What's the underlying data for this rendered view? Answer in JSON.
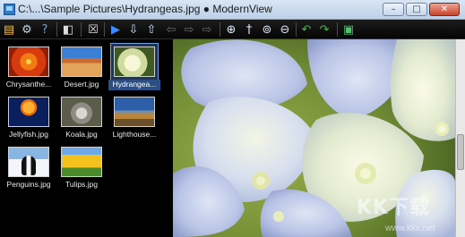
{
  "window": {
    "title": "C:\\...\\Sample Pictures\\Hydrangeas.jpg ● ModernView",
    "minimize_glyph": "–",
    "maximize_glyph": "□",
    "close_glyph": "✕"
  },
  "toolbar": {
    "icons": [
      {
        "name": "open-folder-icon",
        "glyph": "▤",
        "color": "#f0c14b"
      },
      {
        "name": "settings-icon",
        "glyph": "⚙",
        "color": "#c7d3e4"
      },
      {
        "name": "help-icon",
        "glyph": "?",
        "color": "#5aa6ff"
      },
      {
        "name": "panel-toggle-icon",
        "glyph": "◧",
        "color": "#dddddd"
      },
      {
        "name": "delete-icon",
        "glyph": "☒",
        "color": "#dddddd"
      },
      {
        "name": "play-slideshow-icon",
        "glyph": "▶",
        "color": "#3b8cff"
      },
      {
        "name": "download-arrow-icon",
        "glyph": "⇩",
        "color": "#cfe3ff"
      },
      {
        "name": "up-arrow-icon",
        "glyph": "⇧",
        "color": "#cfe3ff"
      },
      {
        "name": "previous-icon",
        "glyph": "⇦",
        "color": "#6a6a6a"
      },
      {
        "name": "skip-icon",
        "glyph": "⇨",
        "color": "#6a6a6a"
      },
      {
        "name": "next-icon",
        "glyph": "⇨",
        "color": "#6a6a6a"
      },
      {
        "name": "zoom-in-icon",
        "glyph": "⊕",
        "color": "#dfe9f5"
      },
      {
        "name": "pin-icon",
        "glyph": "†",
        "color": "#dfe9f5"
      },
      {
        "name": "magnifier-icon",
        "glyph": "⊚",
        "color": "#dfe9f5"
      },
      {
        "name": "zoom-out-icon",
        "glyph": "⊖",
        "color": "#dfe9f5"
      },
      {
        "name": "rotate-left-icon",
        "glyph": "↶",
        "color": "#3fbf3f"
      },
      {
        "name": "rotate-right-icon",
        "glyph": "↷",
        "color": "#3fbf3f"
      },
      {
        "name": "fullscreen-monitor-icon",
        "glyph": "▣",
        "color": "#4fc16a"
      }
    ]
  },
  "thumbnails": [
    {
      "label": "Chrysanthe...",
      "art": "t-chrys",
      "selected": false
    },
    {
      "label": "Desert.jpg",
      "art": "t-desert",
      "selected": false
    },
    {
      "label": "Hydrangea...",
      "art": "t-hydr",
      "selected": true
    },
    {
      "label": "Jellyfish.jpg",
      "art": "t-jelly",
      "selected": false
    },
    {
      "label": "Koala.jpg",
      "art": "t-koala",
      "selected": false
    },
    {
      "label": "Lighthouse...",
      "art": "t-light",
      "selected": false
    },
    {
      "label": "Penguins.jpg",
      "art": "t-peng",
      "selected": false
    },
    {
      "label": "Tulips.jpg",
      "art": "t-tulip",
      "selected": false
    }
  ],
  "watermark": {
    "text": "KK下载",
    "url": "www.kkx.net"
  }
}
